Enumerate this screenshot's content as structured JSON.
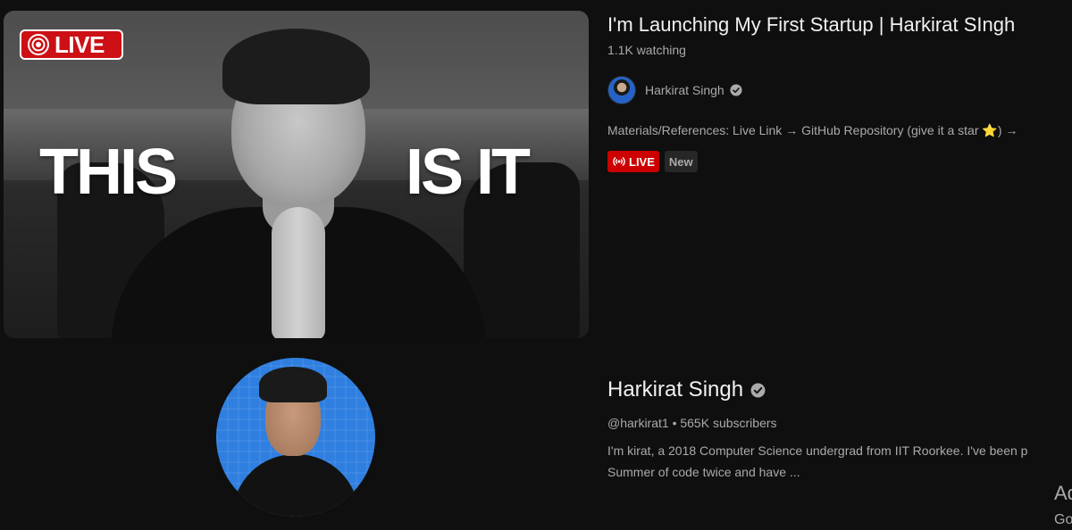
{
  "video": {
    "thumbnail": {
      "live_label": "LIVE",
      "text_left": "THIS",
      "text_right": "IS IT"
    },
    "title": "I'm Launching My First Startup | Harkirat SIngh",
    "watching": "1.1K watching",
    "channel_name": "Harkirat Singh",
    "description": "Materials/References: Live Link → GitHub Repository (give it a star ⭐) →",
    "badge_live": "LIVE",
    "badge_new": "New"
  },
  "channel": {
    "name": "Harkirat Singh",
    "meta": "@harkirat1 • 565K subscribers",
    "description_line1": "I'm kirat, a 2018 Computer Science undergrad from IIT Roorkee. I've been p",
    "description_line2": "Summer of code twice and have ..."
  },
  "edge": {
    "text_a": "Ad",
    "text_b": "Go"
  },
  "colors": {
    "background": "#0f0f0f",
    "live_red": "#cc0000",
    "text_primary": "#f1f1f1",
    "text_secondary": "#aaaaaa"
  },
  "icons": {
    "verified": "verified-check-icon",
    "live": "live-broadcast-icon"
  }
}
